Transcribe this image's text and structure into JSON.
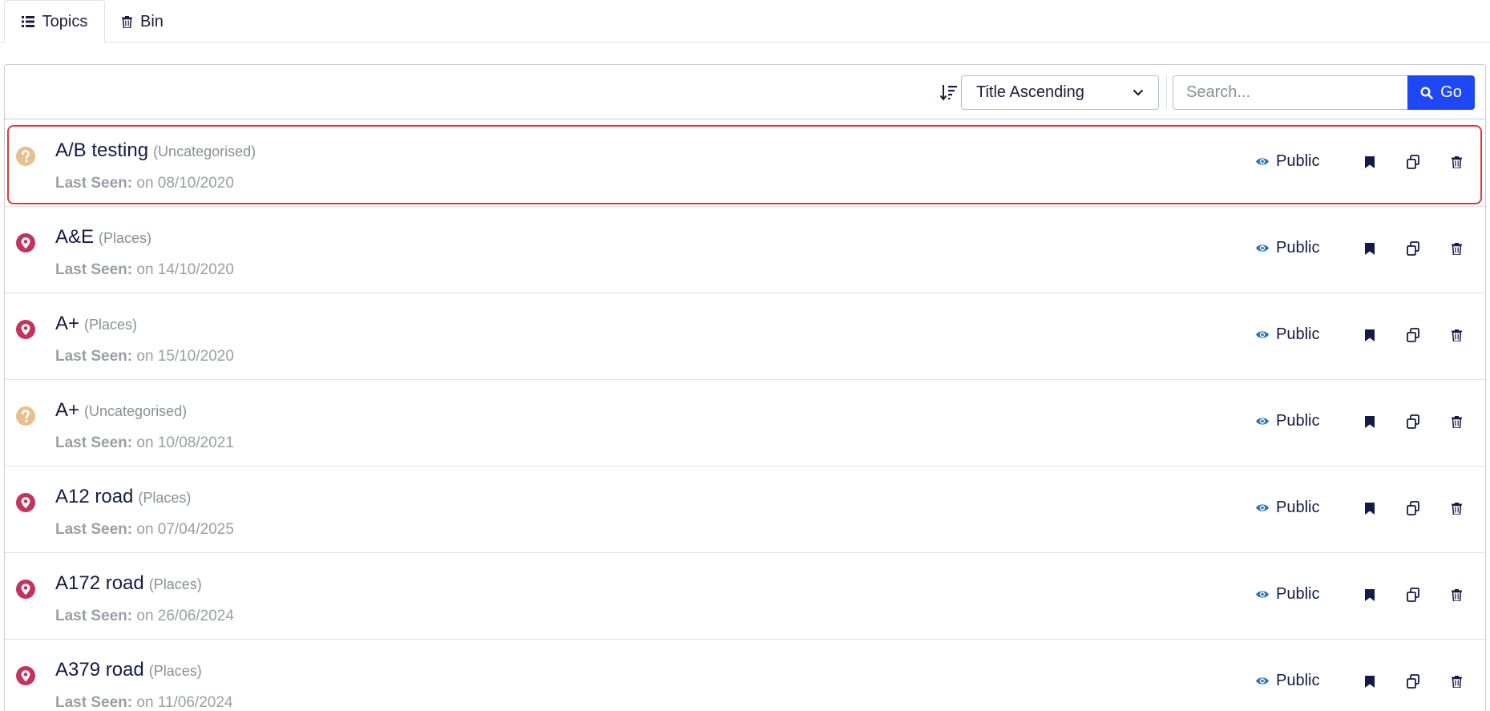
{
  "tabs": [
    {
      "label": "Topics",
      "icon": "list-icon",
      "active": true
    },
    {
      "label": "Bin",
      "icon": "trash-icon",
      "active": false
    }
  ],
  "toolbar": {
    "sort_selected": "Title Ascending",
    "search_placeholder": "Search...",
    "go_label": "Go"
  },
  "colors": {
    "accent": "#1e47f5",
    "place_icon": "#c2345f",
    "uncategorised_icon": "#e8bf8d",
    "visibility_icon": "#2b78b6",
    "selection": "#e03a3a"
  },
  "last_seen_label": "Last Seen:",
  "topics": [
    {
      "title": "A/B testing",
      "category": "(Uncategorised)",
      "type": "uncategorised",
      "last_seen": "on 08/10/2020",
      "visibility": "Public",
      "selected": true
    },
    {
      "title": "A&E",
      "category": "(Places)",
      "type": "place",
      "last_seen": "on 14/10/2020",
      "visibility": "Public",
      "selected": false
    },
    {
      "title": "A+",
      "category": "(Places)",
      "type": "place",
      "last_seen": "on 15/10/2020",
      "visibility": "Public",
      "selected": false
    },
    {
      "title": "A+",
      "category": "(Uncategorised)",
      "type": "uncategorised",
      "last_seen": "on 10/08/2021",
      "visibility": "Public",
      "selected": false
    },
    {
      "title": "A12 road",
      "category": "(Places)",
      "type": "place",
      "last_seen": "on 07/04/2025",
      "visibility": "Public",
      "selected": false
    },
    {
      "title": "A172 road",
      "category": "(Places)",
      "type": "place",
      "last_seen": "on 26/06/2024",
      "visibility": "Public",
      "selected": false
    },
    {
      "title": "A379 road",
      "category": "(Places)",
      "type": "place",
      "last_seen": "on 11/06/2024",
      "visibility": "Public",
      "selected": false
    }
  ]
}
